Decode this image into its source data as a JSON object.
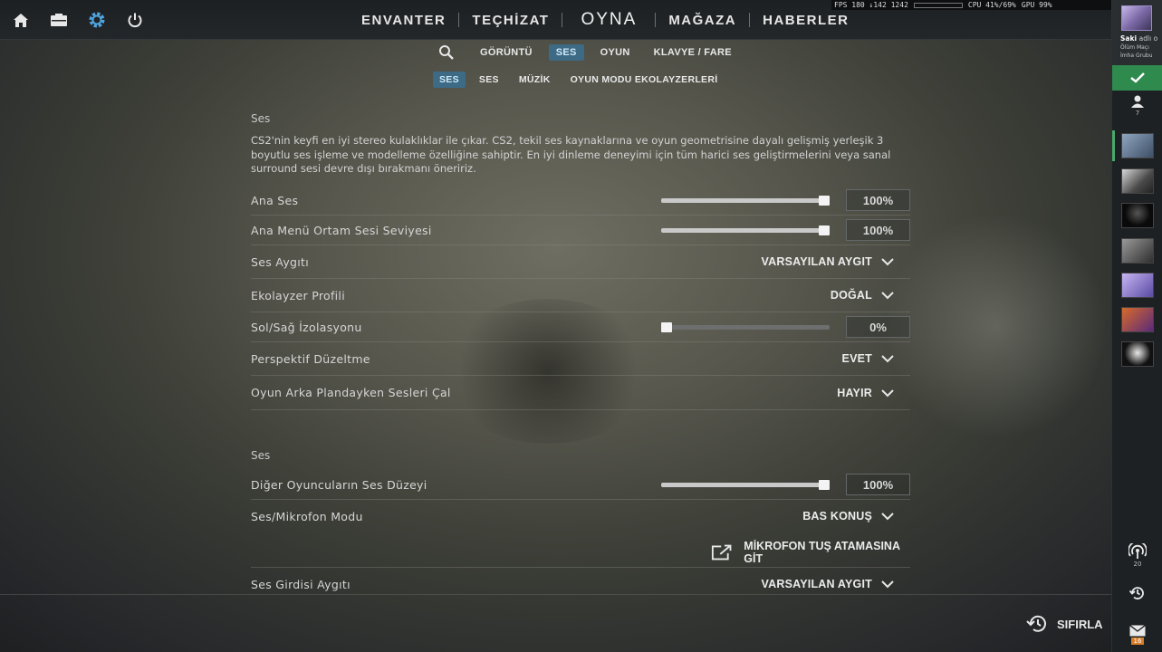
{
  "top_bar": {
    "nav": [
      {
        "label": "ENVANTER",
        "active": false
      },
      {
        "label": "TEÇHİZAT",
        "active": false
      },
      {
        "label": "OYNA",
        "active": true
      },
      {
        "label": "MAĞAZA",
        "active": false
      },
      {
        "label": "HABERLER",
        "active": false
      }
    ],
    "icons": [
      "home-icon",
      "inventory-icon",
      "settings-gear-icon",
      "power-icon"
    ],
    "stats": {
      "fps": "FPS 180 ↓142 1242",
      "cpu": "CPU 41%/69%",
      "gpu": "GPU 99%"
    }
  },
  "settings_tabs": [
    "GÖRÜNTÜ",
    "SES",
    "OYUN",
    "KLAVYE / FARE"
  ],
  "settings_tabs_active": "SES",
  "sound_tabs": [
    "SES",
    "SES",
    "MÜZİK",
    "OYUN MODU EKOLAYZERLERİ"
  ],
  "sound_tabs_active_index": 0,
  "section1": {
    "title": "Ses",
    "description": "CS2'nin keyfi en iyi stereo kulaklıklar ile çıkar. CS2, tekil ses kaynaklarına ve oyun geometrisine dayalı gelişmiş yerleşik 3 boyutlu ses işleme ve modelleme özelliğine sahiptir. En iyi dinleme deneyimi için tüm harici ses geliştirmelerini veya sanal surround sesi devre dışı bırakmanı öneririz.",
    "rows": [
      {
        "label": "Ana Ses",
        "type": "slider",
        "value": "100%",
        "level": 1.0
      },
      {
        "label": "Ana Menü Ortam Sesi Seviyesi",
        "type": "slider",
        "value": "100%",
        "level": 1.0
      },
      {
        "label": "Ses Aygıtı",
        "type": "dropdown",
        "value": "VARSAYILAN AYGIT"
      },
      {
        "label": "Ekolayzer Profili",
        "type": "dropdown",
        "value": "DOĞAL"
      },
      {
        "label": "Sol/Sağ İzolasyonu",
        "type": "slider",
        "value": "0%",
        "level": 0.0
      },
      {
        "label": "Perspektif Düzeltme",
        "type": "dropdown",
        "value": "EVET"
      },
      {
        "label": "Oyun Arka Plandayken Sesleri Çal",
        "type": "dropdown",
        "value": "HAYIR"
      }
    ]
  },
  "section2": {
    "title": "Ses",
    "rows": [
      {
        "label": "Diğer Oyuncuların Ses Düzeyi",
        "type": "slider",
        "value": "100%",
        "level": 1.0
      },
      {
        "label": "Ses/Mikrofon Modu",
        "type": "dropdown",
        "value": "BAS KONUŞ"
      },
      {
        "label": "MİKROFON TUŞ ATAMASINA GİT",
        "type": "link"
      },
      {
        "label": "Ses Girdisi Aygıtı",
        "type": "dropdown",
        "value": "VARSAYILAN AYGIT"
      }
    ]
  },
  "reset_label": "SIFIRLA",
  "sidebar": {
    "profile_name": "Saki",
    "profile_name_suffix": "adlı o",
    "profile_line2": "Ölüm Maçı",
    "profile_line3": "İmha Grubu",
    "friends_count": "7",
    "ping_count": "20",
    "mail_count": "16"
  }
}
